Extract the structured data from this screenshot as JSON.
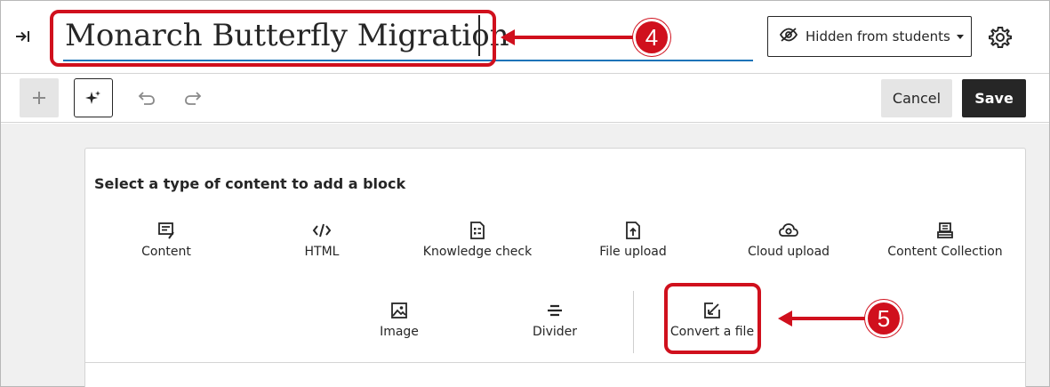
{
  "header": {
    "title": "Monarch Butterfly Migration",
    "visibility_label": "Hidden from students",
    "collapse_icon": "panel-collapse-icon",
    "settings_icon": "gear-icon"
  },
  "toolbar": {
    "add_icon": "plus-icon",
    "magic_icon": "sparkle-icon",
    "undo_icon": "undo-icon",
    "redo_icon": "redo-icon",
    "cancel_label": "Cancel",
    "save_label": "Save"
  },
  "panel": {
    "heading": "Select a type of content to add a block",
    "row1": [
      {
        "label": "Content",
        "icon": "content-icon"
      },
      {
        "label": "HTML",
        "icon": "code-icon"
      },
      {
        "label": "Knowledge check",
        "icon": "knowledge-check-icon"
      },
      {
        "label": "File upload",
        "icon": "file-upload-icon"
      },
      {
        "label": "Cloud upload",
        "icon": "cloud-upload-icon"
      },
      {
        "label": "Content Collection",
        "icon": "content-collection-icon"
      }
    ],
    "row2": [
      {
        "label": "Image",
        "icon": "image-icon"
      },
      {
        "label": "Divider",
        "icon": "divider-icon"
      },
      {
        "label": "Convert a file",
        "icon": "convert-file-icon"
      }
    ]
  },
  "annotations": {
    "step_title": "4",
    "step_convert": "5",
    "color": "#d0101d"
  }
}
